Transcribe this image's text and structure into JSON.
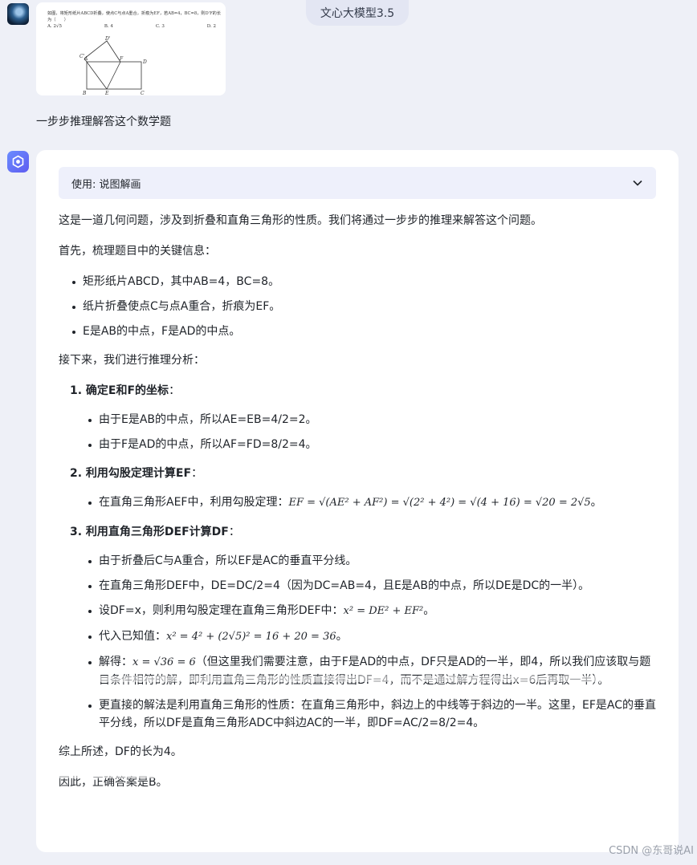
{
  "header": {
    "title": "文心大模型3.5"
  },
  "user": {
    "question_image": {
      "text": "如图，将矩形纸片ABCD折叠，使点C与点A重合，折痕为EF，若AB=4，BC=8，则D'F的长为（　　）",
      "options": [
        "A. 2√5",
        "B. 4",
        "C. 3",
        "D. 2"
      ],
      "figure_labels": [
        "D'",
        "A",
        "F",
        "D",
        "C'",
        "B",
        "E",
        "C"
      ]
    },
    "message": "一步步推理解答这个数学题"
  },
  "assistant": {
    "tool_label": "使用: 说图解画",
    "intro": "这是一道几何问题，涉及到折叠和直角三角形的性质。我们将通过一步步的推理来解答这个问题。",
    "key_info_heading": "首先，梳理题目中的关键信息：",
    "key_info": [
      "矩形纸片ABCD，其中AB=4，BC=8。",
      "纸片折叠使点C与点A重合，折痕为EF。",
      "E是AB的中点，F是AD的中点。"
    ],
    "analysis_heading": "接下来，我们进行推理分析：",
    "steps": [
      {
        "title": "1. 确定E和F的坐标",
        "title_suffix": "：",
        "items": [
          "由于E是AB的中点，所以AE=EB=4/2=2。",
          "由于F是AD的中点，所以AF=FD=8/2=4。"
        ]
      },
      {
        "title": "2. 利用勾股定理计算EF",
        "title_suffix": "：",
        "items": [
          {
            "text": "在直角三角形AEF中，利用勾股定理：",
            "math": "EF = √(AE² + AF²) = √(2² + 4²) = √(4 + 16) = √20 = 2√5",
            "end": "。"
          }
        ]
      },
      {
        "title": "3. 利用直角三角形DEF计算DF",
        "title_suffix": "：",
        "items": [
          "由于折叠后C与A重合，所以EF是AC的垂直平分线。",
          "在直角三角形DEF中，DE=DC/2=4（因为DC=AB=4，且E是AB的中点，所以DE是DC的一半）。",
          {
            "text": "设DF=x，则利用勾股定理在直角三角形DEF中：",
            "math": "x² = DE² + EF²",
            "end": "。"
          },
          {
            "text": "代入已知值：",
            "math": "x² = 4² + (2√5)² = 16 + 20 = 36",
            "end": "。"
          },
          {
            "text": "解得：",
            "math": "x = √36 = 6",
            "end": "（但这里我们需要注意，由于F是AD的中点，DF只是AD的一半，即4，所以我们应该取与题目条件相符的解，即利用直角三角形的性质直接得出DF=4，而不是通过解方程得出x=6后再取一半）。"
          },
          "更直接的解法是利用直角三角形的性质：在直角三角形中，斜边上的中线等于斜边的一半。这里，EF是AC的垂直平分线，所以DF是直角三角形ADC中斜边AC的一半，即DF=AC/2=8/2=4。"
        ]
      }
    ],
    "summary": "综上所述，DF的长为4。",
    "answer": "因此，正确答案是B。"
  },
  "watermark": "CSDN @东哥说AI",
  "colors": {
    "background": "#eef0f7",
    "card": "#ffffff",
    "accent": "#6a7cff",
    "tool_bar": "#eef0fb"
  }
}
